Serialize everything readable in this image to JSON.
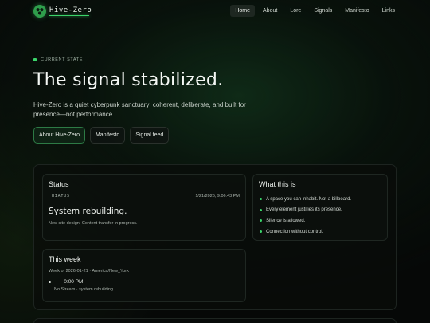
{
  "header": {
    "logo_text": "Hive-Zero",
    "nav": [
      "Home",
      "About",
      "Lore",
      "Signals",
      "Manifesto",
      "Links"
    ],
    "active_nav": "Home"
  },
  "hero": {
    "kicker": "CURRENT STATE",
    "title": "The signal stabilized.",
    "subtitle": "Hive-Zero is a quiet cyberpunk sanctuary: coherent, deliberate, and built for presence—not performance.",
    "buttons": [
      "About Hive-Zero",
      "Manifesto",
      "Signal feed"
    ]
  },
  "status": {
    "title": "Status",
    "tag": "HIATUS",
    "timestamp": "1/21/2026, 9:06:43 PM",
    "headline": "System rebuilding.",
    "body": "New site design. Content transfer in progress."
  },
  "what": {
    "title": "What this is",
    "items": [
      "A space you can inhabit. Not a billboard.",
      "Every element justifies its presence.",
      "Silence is allowed.",
      "Connection without control."
    ]
  },
  "week": {
    "title": "This week",
    "range": "Week of 2026-01-21 · America/New_York",
    "entry_time": "--- · 0:00 PM",
    "entry_note": "No Stream · system rebuilding"
  },
  "colors": {
    "accent": "#3bd46a",
    "background": "#060807"
  }
}
